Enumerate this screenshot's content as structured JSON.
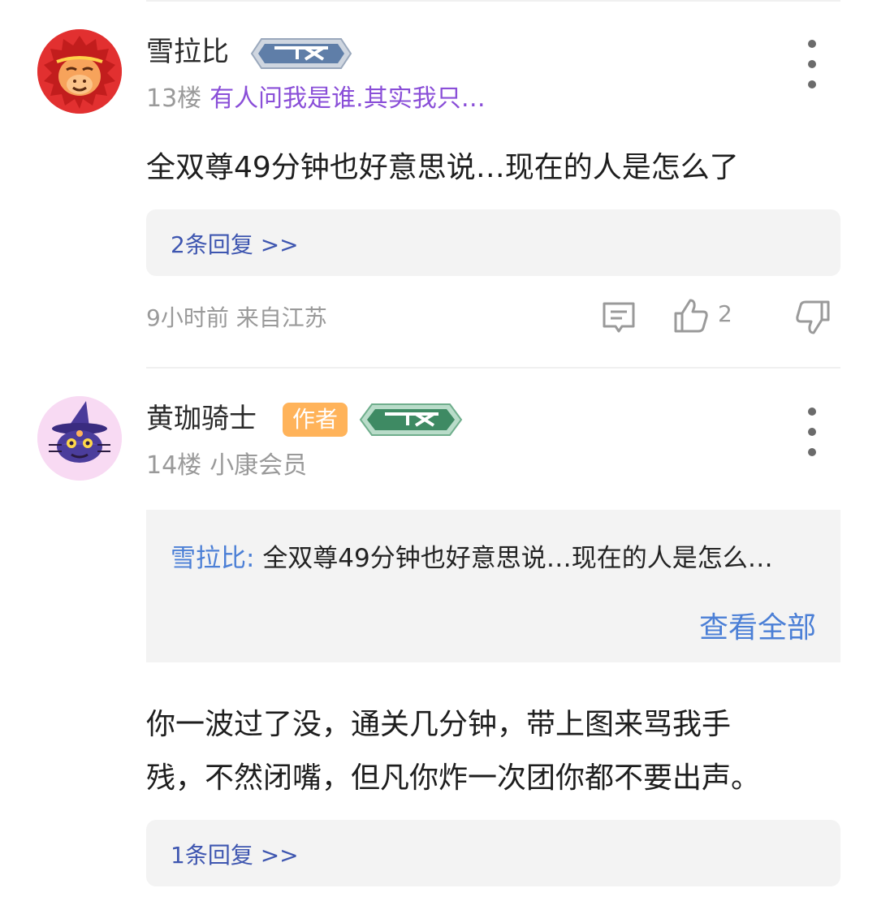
{
  "comments": [
    {
      "username": "雪拉比",
      "floor": "13楼",
      "signature": "有人问我是谁.其实我只…",
      "content": "全双尊49分钟也好意思说…现在的人是怎么了",
      "replies_label": "2条回复 >>",
      "time_location": "9小时前 来自江苏",
      "like_count": "2",
      "level_badge": "blue-level-badge",
      "avatar_icon": "red-monkey-avatar"
    },
    {
      "username": "黄珈骑士",
      "author_tag": "作者",
      "floor": "14楼",
      "signature": "小康会员",
      "quote_name": "雪拉比:",
      "quote_text": "全双尊49分钟也好意思说…现在的人是怎么…",
      "quote_more": "查看全部",
      "content_line1": "你一波过了没，通关几分钟，带上图来骂我手",
      "content_line2": "残，不然闭嘴，但凡你炸一次团你都不要出声。",
      "replies_label": "1条回复 >>",
      "level_badge": "green-level-badge",
      "avatar_icon": "witch-cat-avatar"
    }
  ],
  "colors": {
    "accent_blue": "#3e56b0",
    "link_blue": "#4b7fd6",
    "signature_purple": "#8a4fd8",
    "author_orange": "#ffb35a"
  }
}
